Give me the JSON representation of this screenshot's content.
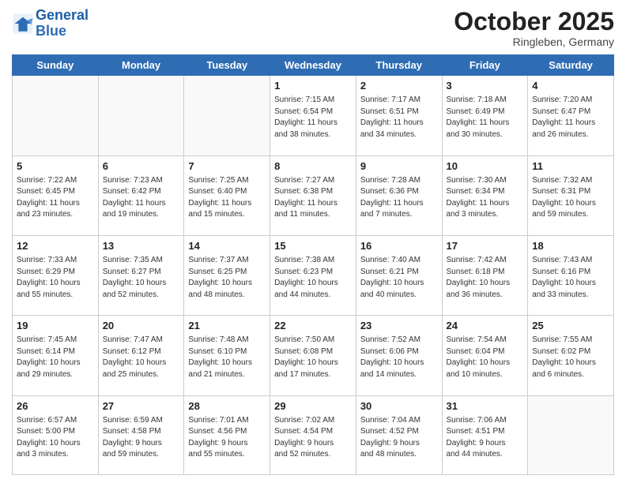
{
  "logo": {
    "line1": "General",
    "line2": "Blue"
  },
  "title": "October 2025",
  "subtitle": "Ringleben, Germany",
  "days_of_week": [
    "Sunday",
    "Monday",
    "Tuesday",
    "Wednesday",
    "Thursday",
    "Friday",
    "Saturday"
  ],
  "weeks": [
    [
      {
        "day": "",
        "info": ""
      },
      {
        "day": "",
        "info": ""
      },
      {
        "day": "",
        "info": ""
      },
      {
        "day": "1",
        "info": "Sunrise: 7:15 AM\nSunset: 6:54 PM\nDaylight: 11 hours\nand 38 minutes."
      },
      {
        "day": "2",
        "info": "Sunrise: 7:17 AM\nSunset: 6:51 PM\nDaylight: 11 hours\nand 34 minutes."
      },
      {
        "day": "3",
        "info": "Sunrise: 7:18 AM\nSunset: 6:49 PM\nDaylight: 11 hours\nand 30 minutes."
      },
      {
        "day": "4",
        "info": "Sunrise: 7:20 AM\nSunset: 6:47 PM\nDaylight: 11 hours\nand 26 minutes."
      }
    ],
    [
      {
        "day": "5",
        "info": "Sunrise: 7:22 AM\nSunset: 6:45 PM\nDaylight: 11 hours\nand 23 minutes."
      },
      {
        "day": "6",
        "info": "Sunrise: 7:23 AM\nSunset: 6:42 PM\nDaylight: 11 hours\nand 19 minutes."
      },
      {
        "day": "7",
        "info": "Sunrise: 7:25 AM\nSunset: 6:40 PM\nDaylight: 11 hours\nand 15 minutes."
      },
      {
        "day": "8",
        "info": "Sunrise: 7:27 AM\nSunset: 6:38 PM\nDaylight: 11 hours\nand 11 minutes."
      },
      {
        "day": "9",
        "info": "Sunrise: 7:28 AM\nSunset: 6:36 PM\nDaylight: 11 hours\nand 7 minutes."
      },
      {
        "day": "10",
        "info": "Sunrise: 7:30 AM\nSunset: 6:34 PM\nDaylight: 11 hours\nand 3 minutes."
      },
      {
        "day": "11",
        "info": "Sunrise: 7:32 AM\nSunset: 6:31 PM\nDaylight: 10 hours\nand 59 minutes."
      }
    ],
    [
      {
        "day": "12",
        "info": "Sunrise: 7:33 AM\nSunset: 6:29 PM\nDaylight: 10 hours\nand 55 minutes."
      },
      {
        "day": "13",
        "info": "Sunrise: 7:35 AM\nSunset: 6:27 PM\nDaylight: 10 hours\nand 52 minutes."
      },
      {
        "day": "14",
        "info": "Sunrise: 7:37 AM\nSunset: 6:25 PM\nDaylight: 10 hours\nand 48 minutes."
      },
      {
        "day": "15",
        "info": "Sunrise: 7:38 AM\nSunset: 6:23 PM\nDaylight: 10 hours\nand 44 minutes."
      },
      {
        "day": "16",
        "info": "Sunrise: 7:40 AM\nSunset: 6:21 PM\nDaylight: 10 hours\nand 40 minutes."
      },
      {
        "day": "17",
        "info": "Sunrise: 7:42 AM\nSunset: 6:18 PM\nDaylight: 10 hours\nand 36 minutes."
      },
      {
        "day": "18",
        "info": "Sunrise: 7:43 AM\nSunset: 6:16 PM\nDaylight: 10 hours\nand 33 minutes."
      }
    ],
    [
      {
        "day": "19",
        "info": "Sunrise: 7:45 AM\nSunset: 6:14 PM\nDaylight: 10 hours\nand 29 minutes."
      },
      {
        "day": "20",
        "info": "Sunrise: 7:47 AM\nSunset: 6:12 PM\nDaylight: 10 hours\nand 25 minutes."
      },
      {
        "day": "21",
        "info": "Sunrise: 7:48 AM\nSunset: 6:10 PM\nDaylight: 10 hours\nand 21 minutes."
      },
      {
        "day": "22",
        "info": "Sunrise: 7:50 AM\nSunset: 6:08 PM\nDaylight: 10 hours\nand 17 minutes."
      },
      {
        "day": "23",
        "info": "Sunrise: 7:52 AM\nSunset: 6:06 PM\nDaylight: 10 hours\nand 14 minutes."
      },
      {
        "day": "24",
        "info": "Sunrise: 7:54 AM\nSunset: 6:04 PM\nDaylight: 10 hours\nand 10 minutes."
      },
      {
        "day": "25",
        "info": "Sunrise: 7:55 AM\nSunset: 6:02 PM\nDaylight: 10 hours\nand 6 minutes."
      }
    ],
    [
      {
        "day": "26",
        "info": "Sunrise: 6:57 AM\nSunset: 5:00 PM\nDaylight: 10 hours\nand 3 minutes."
      },
      {
        "day": "27",
        "info": "Sunrise: 6:59 AM\nSunset: 4:58 PM\nDaylight: 9 hours\nand 59 minutes."
      },
      {
        "day": "28",
        "info": "Sunrise: 7:01 AM\nSunset: 4:56 PM\nDaylight: 9 hours\nand 55 minutes."
      },
      {
        "day": "29",
        "info": "Sunrise: 7:02 AM\nSunset: 4:54 PM\nDaylight: 9 hours\nand 52 minutes."
      },
      {
        "day": "30",
        "info": "Sunrise: 7:04 AM\nSunset: 4:52 PM\nDaylight: 9 hours\nand 48 minutes."
      },
      {
        "day": "31",
        "info": "Sunrise: 7:06 AM\nSunset: 4:51 PM\nDaylight: 9 hours\nand 44 minutes."
      },
      {
        "day": "",
        "info": ""
      }
    ]
  ]
}
